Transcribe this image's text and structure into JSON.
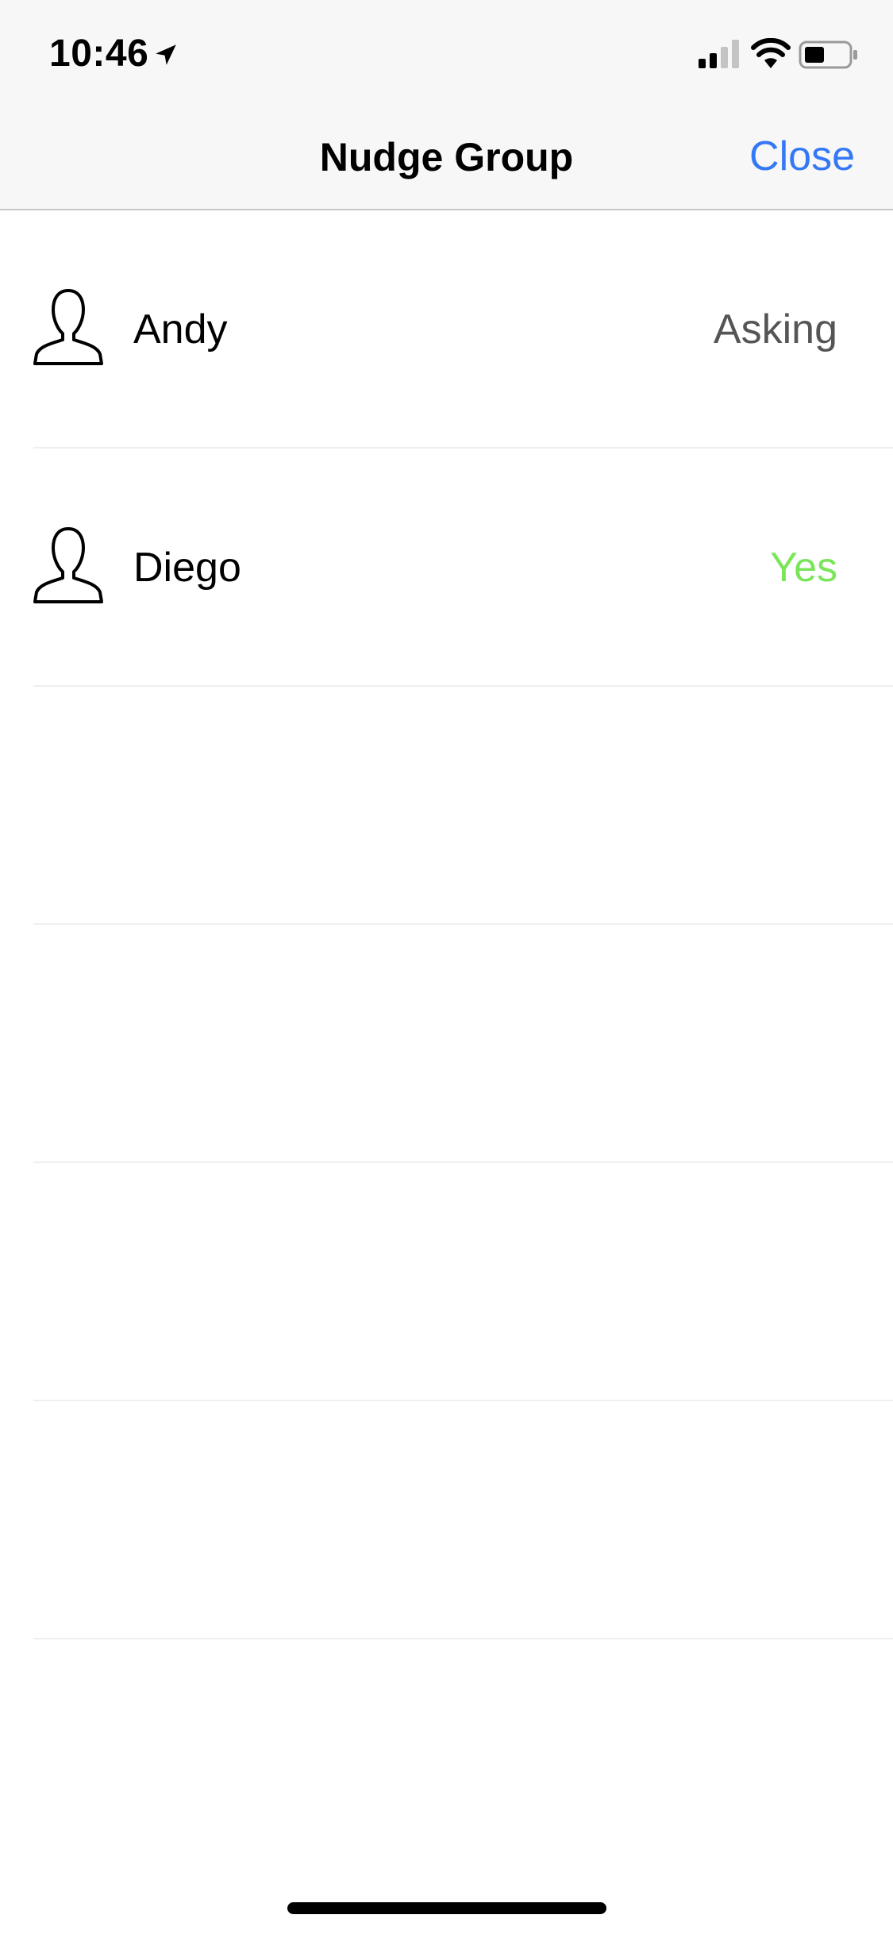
{
  "status_bar": {
    "time": "10:46",
    "icons": [
      "location-arrow-icon",
      "cellular-signal-icon",
      "wifi-icon",
      "battery-icon"
    ]
  },
  "nav": {
    "title": "Nudge Group",
    "close_label": "Close"
  },
  "members": [
    {
      "name": "Andy",
      "status": "Asking",
      "status_color": "#555555",
      "icon": "person-icon"
    },
    {
      "name": "Diego",
      "status": "Yes",
      "status_color": "#7be55a",
      "icon": "person-icon"
    }
  ],
  "empty_rows": 4,
  "colors": {
    "accent": "#3478f6",
    "yes": "#7be55a",
    "asking": "#555555"
  }
}
